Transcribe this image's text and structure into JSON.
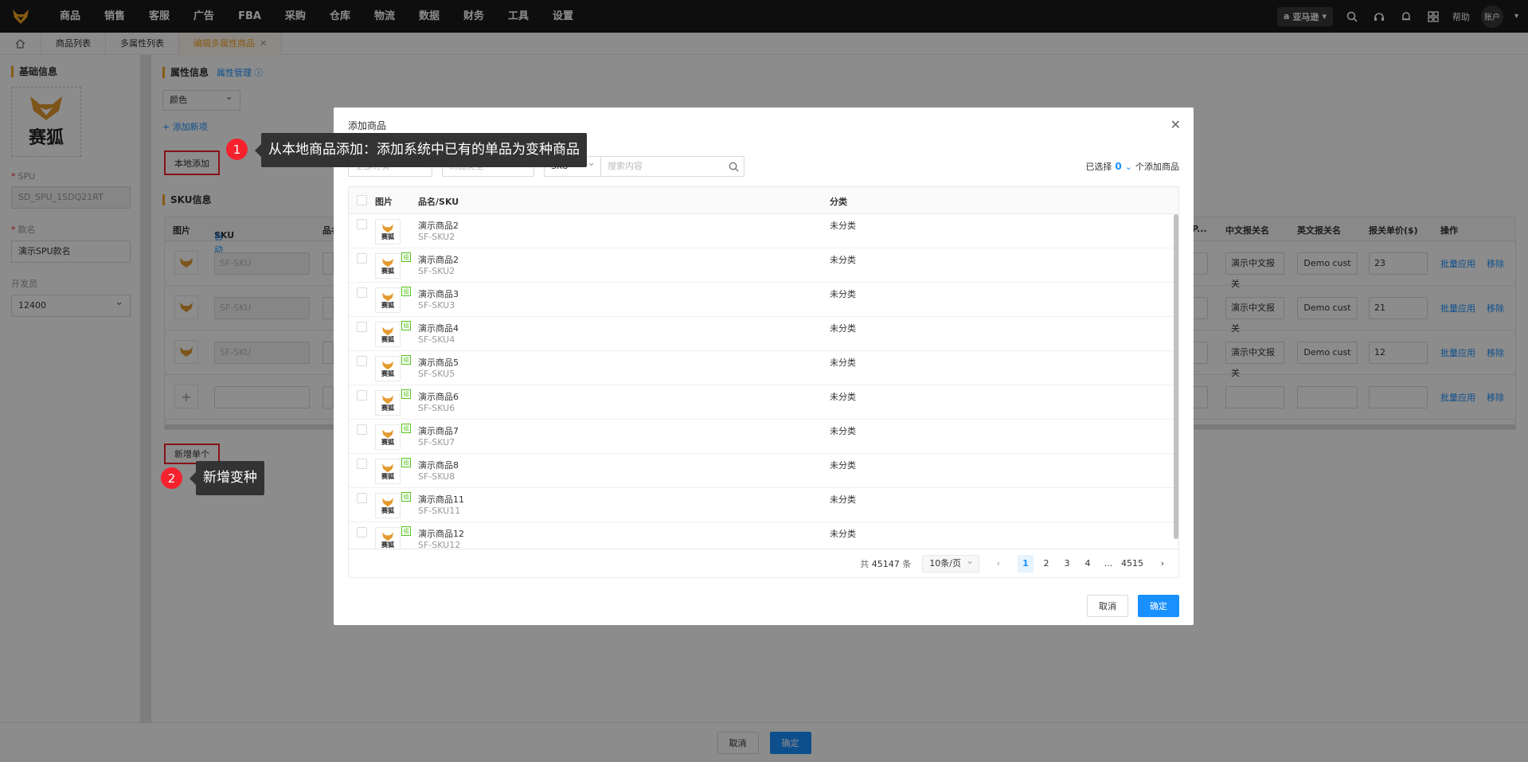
{
  "nav": {
    "items": [
      "商品",
      "销售",
      "客服",
      "广告",
      "FBA",
      "采购",
      "仓库",
      "物流",
      "数据",
      "财务",
      "工具",
      "设置"
    ],
    "amazon": "亚马逊",
    "help": "帮助",
    "user": "账户"
  },
  "tabs": [
    "商品列表",
    "多属性列表",
    "编辑多属性商品"
  ],
  "left": {
    "title": "基础信息",
    "logo_text": "赛狐",
    "spu_label": "SPU",
    "spu_value": "SD_SPU_1SDQ21RT",
    "name_label": "款名",
    "name_value": "演示SPU款名",
    "dev_label": "开发员",
    "dev_value": "12400"
  },
  "attr": {
    "title": "属性信息",
    "manage": "属性管理",
    "color": "颜色",
    "add_new": "+ 添加新项",
    "local_add": "本地添加"
  },
  "sku": {
    "title": "SKU信息",
    "headers": {
      "img": "图片",
      "sku": "SKU",
      "auto": "自动",
      "name": "品名",
      "p": "P...",
      "cn": "中文报关名",
      "en": "英文报关名",
      "price": "报关单价($)",
      "op": "操作"
    },
    "placeholder": "SF-SKU",
    "cn_val": "演示中文报关",
    "en_val": "Demo cust",
    "prices": [
      "23",
      "21",
      "12"
    ],
    "batch": "批量应用",
    "remove": "移除",
    "add_single": "新增单个"
  },
  "footer": {
    "cancel": "取消",
    "ok": "确定"
  },
  "modal": {
    "title": "添加商品",
    "filter1": "全部分类",
    "filter2": "商品类型",
    "sku_sel": "SKU",
    "search_placeholder": "搜索内容",
    "selected_prefix": "已选择",
    "selected_count": "0",
    "selected_suffix": "个添加商品",
    "col_img": "图片",
    "col_name": "品名/SKU",
    "col_cat": "分类",
    "rows": [
      {
        "name": "演示商品2",
        "sku": "SF-SKU2",
        "cat": "未分类",
        "tag": false
      },
      {
        "name": "演示商品2",
        "sku": "SF-SKU2",
        "cat": "未分类",
        "tag": true
      },
      {
        "name": "演示商品3",
        "sku": "SF-SKU3",
        "cat": "未分类",
        "tag": true
      },
      {
        "name": "演示商品4",
        "sku": "SF-SKU4",
        "cat": "未分类",
        "tag": true
      },
      {
        "name": "演示商品5",
        "sku": "SF-SKU5",
        "cat": "未分类",
        "tag": true
      },
      {
        "name": "演示商品6",
        "sku": "SF-SKU6",
        "cat": "未分类",
        "tag": true
      },
      {
        "name": "演示商品7",
        "sku": "SF-SKU7",
        "cat": "未分类",
        "tag": true
      },
      {
        "name": "演示商品8",
        "sku": "SF-SKU8",
        "cat": "未分类",
        "tag": true
      },
      {
        "name": "演示商品11",
        "sku": "SF-SKU11",
        "cat": "未分类",
        "tag": true
      },
      {
        "name": "演示商品12",
        "sku": "SF-SKU12",
        "cat": "未分类",
        "tag": true
      }
    ],
    "thumb_text": "赛狐",
    "tag_text": "组",
    "pager": {
      "total_prefix": "共",
      "total": "45147",
      "total_suffix": "条",
      "size": "10条/页",
      "pages": [
        "1",
        "2",
        "3",
        "4",
        "...",
        "4515"
      ]
    },
    "cancel": "取消",
    "ok": "确定"
  },
  "tips": {
    "t1_num": "1",
    "t1": "从本地商品添加：添加系统中已有的单品为变种商品",
    "t2_num": "2",
    "t2": "新增变种"
  },
  "colors": {
    "brand": "#f5a623",
    "primary": "#1890ff",
    "danger": "#f5222d",
    "nav_bg": "#1b1b1b"
  }
}
